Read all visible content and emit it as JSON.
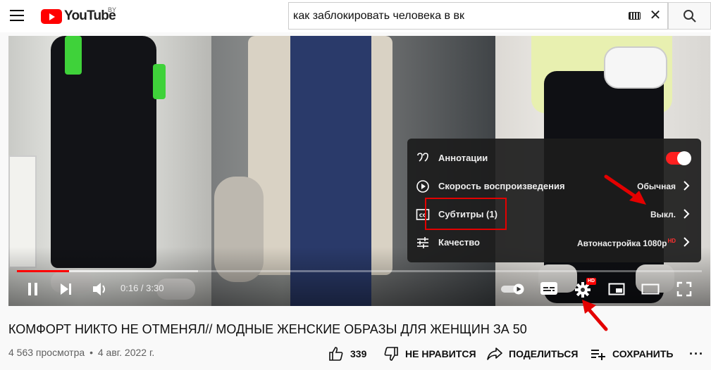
{
  "header": {
    "logo_text": "YouTube",
    "country_code": "BY",
    "search_value": "как заблокировать человека в вк",
    "clear_symbol": "✕"
  },
  "player": {
    "time": "0:16 / 3:30",
    "progress_played_fraction": 0.076,
    "progress_buffered_fraction": 0.264,
    "settings_badge": "HD",
    "settings_menu": {
      "annotations": {
        "label": "Аннотации",
        "toggle_on": true
      },
      "speed": {
        "label": "Скорость воспроизведения",
        "value": "Обычная"
      },
      "subtitles": {
        "label": "Субтитры (1)",
        "value": "Выкл."
      },
      "quality": {
        "label": "Качество",
        "value": "Автонастройка 1080p",
        "value_badge": "HD"
      }
    },
    "accent_color": "#ff0000",
    "annotation_color": "#e40000"
  },
  "video": {
    "title": "КОМФОРТ НИКТО НЕ ОТМЕНЯЛ// МОДНЫЕ ЖЕНСКИЕ ОБРАЗЫ ДЛЯ ЖЕНЩИН ЗА 50",
    "views": "4 563 просмотра",
    "separator": "•",
    "date": "4 авг. 2022 г.",
    "likes": "339",
    "dislike_label": "НЕ НРАВИТСЯ",
    "share_label": "ПОДЕЛИТЬСЯ",
    "save_label": "СОХРАНИТЬ",
    "more_symbol": "···"
  },
  "icons": {
    "menu": "hamburger-icon",
    "search": "search-icon",
    "keyboard": "keyboard-icon",
    "pause": "pause-icon",
    "next": "next-icon",
    "volume": "volume-icon",
    "autoplay": "autoplay-toggle-icon",
    "subtitles": "subtitles-icon",
    "settings": "gear-icon",
    "miniplayer": "miniplayer-icon",
    "theater": "theater-icon",
    "fullscreen": "fullscreen-icon",
    "like": "thumbs-up-icon",
    "dislike": "thumbs-down-icon",
    "share": "share-icon",
    "save": "playlist-add-icon"
  }
}
